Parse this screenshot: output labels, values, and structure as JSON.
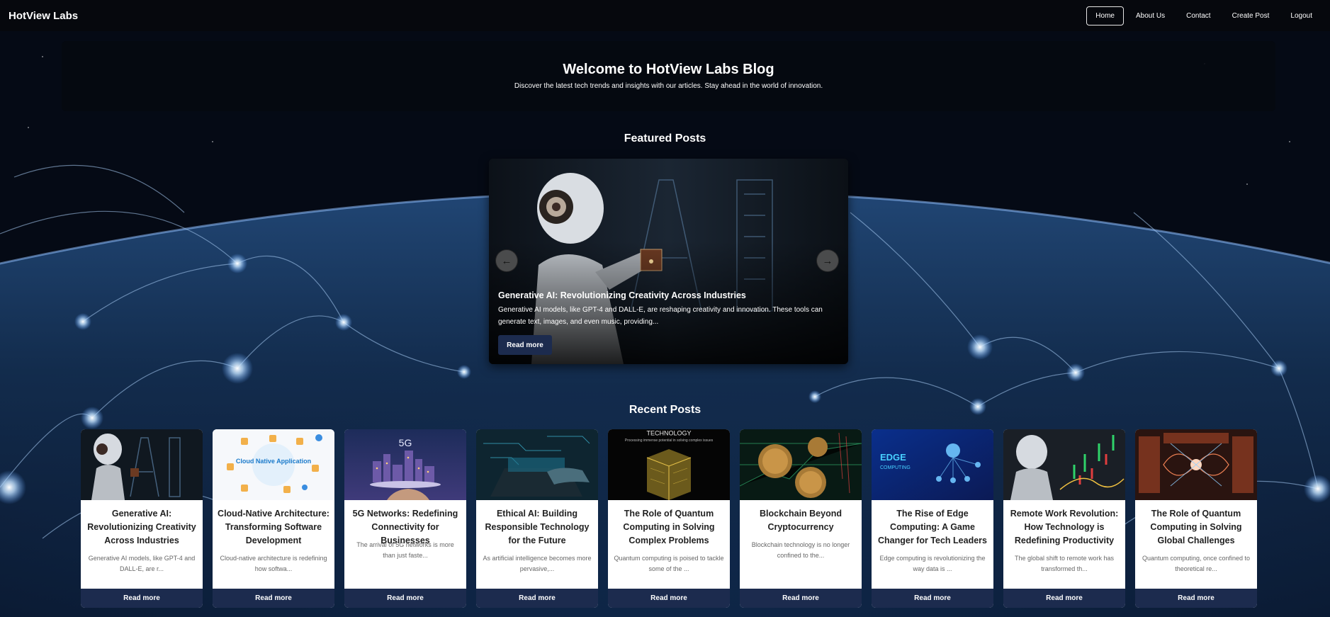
{
  "brand": "HotView Labs",
  "nav": {
    "home": "Home",
    "about": "About Us",
    "contact": "Contact",
    "create_post": "Create Post",
    "logout": "Logout"
  },
  "hero": {
    "title": "Welcome to HotView Labs Blog",
    "subtitle": "Discover the latest tech trends and insights with our articles. Stay ahead in the world of innovation."
  },
  "featured": {
    "heading": "Featured Posts",
    "slide_title": "Generative AI: Revolutionizing Creativity Across Industries",
    "slide_excerpt": "Generative AI models, like GPT-4 and DALL-E, are reshaping creativity and innovation. These tools can generate text, images, and even music, providing...",
    "read_more": "Read more",
    "prev_arrow": "←",
    "next_arrow": "→"
  },
  "recent": {
    "heading": "Recent Posts",
    "read_more": "Read more",
    "posts": [
      {
        "title": "Generative AI: Revolutionizing Creativity Across Industries",
        "excerpt": "Generative AI models, like GPT-4 and DALL-E, are r...",
        "image_icon": "robot-ai-image"
      },
      {
        "title": "Cloud-Native Architecture: Transforming Software Development",
        "excerpt": "Cloud-native architecture is redefining how softwa...",
        "image_icon": "cloud-native-diagram-image",
        "image_text": "Cloud Native Application"
      },
      {
        "title": "5G Networks: Redefining Connectivity for Businesses",
        "excerpt": "The arrival of 5G networks is more than just faste...",
        "image_icon": "5g-city-image",
        "image_text": "5G"
      },
      {
        "title": "Ethical AI: Building Responsible Technology for the Future",
        "excerpt": "As artificial intelligence becomes more pervasive,...",
        "image_icon": "laptop-hands-image"
      },
      {
        "title": "The Role of Quantum Computing in Solving Complex Problems",
        "excerpt": "Quantum computing is poised to tackle some of the ...",
        "image_icon": "quantum-cube-image",
        "image_text": "TECHNOLOGY",
        "image_subtext": "Processing immense potential in solving complex issues"
      },
      {
        "title": "Blockchain Beyond Cryptocurrency",
        "excerpt": "Blockchain technology is no longer confined to the...",
        "image_icon": "crypto-coins-image"
      },
      {
        "title": "The Rise of Edge Computing: A Game Changer for Tech Leaders",
        "excerpt": "Edge computing is revolutionizing the way data is ...",
        "image_icon": "edge-computing-image",
        "image_text": "EDGE",
        "image_text2": "COMPUTING"
      },
      {
        "title": "Remote Work Revolution: How Technology is Redefining Productivity",
        "excerpt": "The global shift to remote work has transformed th...",
        "image_icon": "robot-chart-image"
      },
      {
        "title": "The Role of Quantum Computing in Solving Global Challenges",
        "excerpt": "Quantum computing, once confined to theoretical re...",
        "image_icon": "quantum-light-image"
      }
    ]
  }
}
